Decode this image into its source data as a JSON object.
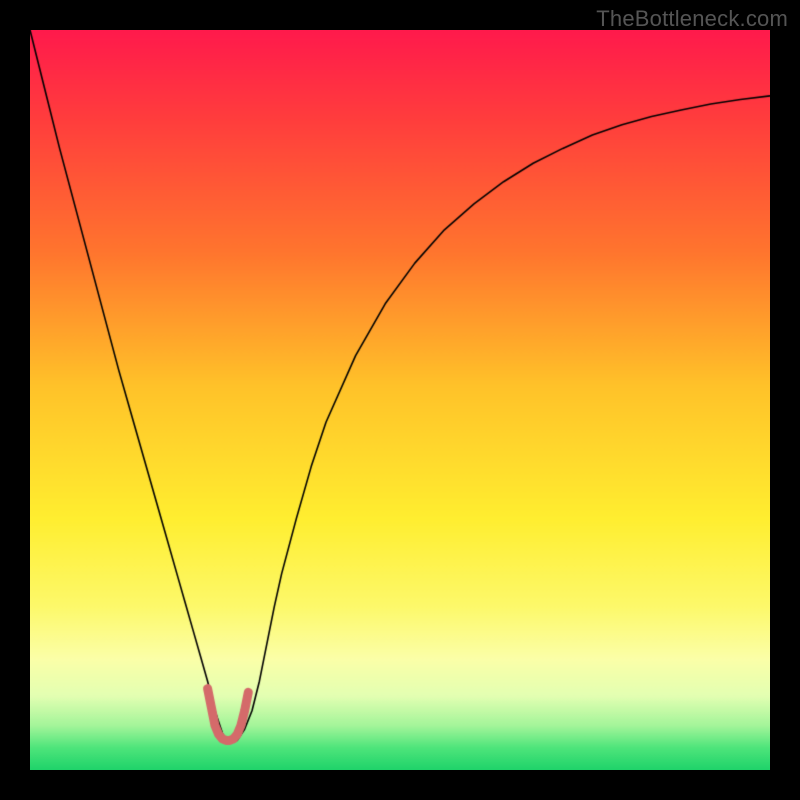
{
  "watermark": "TheBottleneck.com",
  "chart_data": {
    "type": "line",
    "title": "",
    "xlabel": "",
    "ylabel": "",
    "xlim": [
      0,
      100
    ],
    "ylim": [
      0,
      100
    ],
    "gradient_stops": [
      {
        "offset": 0.0,
        "color": "#ff1a4c"
      },
      {
        "offset": 0.12,
        "color": "#ff3d3d"
      },
      {
        "offset": 0.3,
        "color": "#ff752e"
      },
      {
        "offset": 0.48,
        "color": "#ffc229"
      },
      {
        "offset": 0.66,
        "color": "#ffee30"
      },
      {
        "offset": 0.78,
        "color": "#fdf96b"
      },
      {
        "offset": 0.85,
        "color": "#fbffa8"
      },
      {
        "offset": 0.9,
        "color": "#e3ffb2"
      },
      {
        "offset": 0.94,
        "color": "#a4f59a"
      },
      {
        "offset": 0.97,
        "color": "#4ee57b"
      },
      {
        "offset": 1.0,
        "color": "#1fd36a"
      }
    ],
    "series": [
      {
        "name": "curve-black",
        "stroke": "#000000",
        "stroke_width": 1.6,
        "x": [
          0,
          2,
          4,
          6,
          8,
          10,
          12,
          14,
          16,
          18,
          20,
          21,
          22,
          23,
          24,
          25,
          26,
          26.5,
          27,
          28,
          29,
          30,
          31,
          32,
          33,
          34,
          36,
          38,
          40,
          44,
          48,
          52,
          56,
          60,
          64,
          68,
          72,
          76,
          80,
          84,
          88,
          92,
          96,
          100
        ],
        "y": [
          100,
          92,
          84,
          76.5,
          69,
          61.5,
          54,
          47,
          40,
          33,
          26,
          22.5,
          19,
          15.5,
          12,
          8,
          5,
          4,
          4,
          4,
          5.5,
          8,
          12,
          17,
          22,
          26.5,
          34,
          41,
          47,
          56,
          63,
          68.5,
          73,
          76.5,
          79.5,
          82,
          84,
          85.8,
          87.2,
          88.3,
          89.2,
          90,
          90.6,
          91.1
        ]
      },
      {
        "name": "highlight-pink",
        "stroke": "#d46a6a",
        "stroke_width": 9,
        "linecap": "round",
        "x": [
          24.0,
          24.5,
          25.0,
          25.5,
          26.0,
          26.5,
          27.0,
          27.5,
          28.0,
          28.5,
          29.0,
          29.5
        ],
        "y": [
          11.0,
          8.5,
          6.0,
          4.8,
          4.2,
          4.0,
          4.0,
          4.2,
          4.8,
          6.0,
          8.0,
          10.5
        ]
      }
    ]
  }
}
